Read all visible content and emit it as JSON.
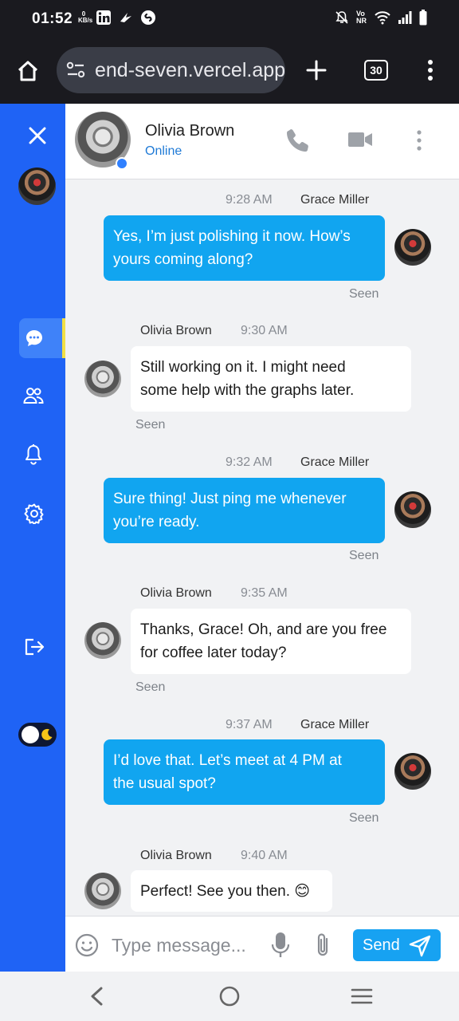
{
  "status_bar": {
    "time": "01:52",
    "data_speed": "0 KB/s",
    "icons_left": [
      "linkedin-icon",
      "bird-icon",
      "shazam-icon"
    ],
    "icons_right": [
      "mute-icon",
      "volte-icon",
      "wifi-icon",
      "signal-icon",
      "battery-icon"
    ]
  },
  "browser": {
    "url": "end-seven.vercel.app",
    "tab_count": "30"
  },
  "sidebar": {
    "items": [
      "close",
      "profile",
      "chats",
      "contacts",
      "notifications",
      "settings",
      "logout",
      "theme-toggle"
    ],
    "active": "chats"
  },
  "header": {
    "contact_name": "Olivia Brown",
    "contact_status": "Online"
  },
  "messages": [
    {
      "direction": "out",
      "sender": "Grace Miller",
      "time": "9:28 AM",
      "lines": [
        "Yes, I’m just polishing it now. How’s",
        "yours coming along?"
      ],
      "status": "Seen"
    },
    {
      "direction": "in",
      "sender": "Olivia Brown",
      "time": "9:30 AM",
      "lines": [
        "Still working on it. I might need",
        "some help with the graphs later."
      ],
      "status": "Seen"
    },
    {
      "direction": "out",
      "sender": "Grace Miller",
      "time": "9:32 AM",
      "lines": [
        "Sure thing! Just ping me whenever",
        "you’re ready."
      ],
      "status": "Seen"
    },
    {
      "direction": "in",
      "sender": "Olivia Brown",
      "time": "9:35 AM",
      "lines": [
        "Thanks, Grace! Oh, and are you free",
        "for coffee later today?"
      ],
      "status": "Seen"
    },
    {
      "direction": "out",
      "sender": "Grace Miller",
      "time": "9:37 AM",
      "lines": [
        "I’d love that. Let’s meet at 4 PM at",
        "the usual spot?"
      ],
      "status": "Seen"
    },
    {
      "direction": "in",
      "sender": "Olivia Brown",
      "time": "9:40 AM",
      "lines": [
        "Perfect! See you then. 😊"
      ],
      "status": ""
    }
  ],
  "composer": {
    "placeholder": "Type message...",
    "send_label": "Send"
  },
  "colors": {
    "sidebar": "#1f63f5",
    "outgoing_bubble": "#11a5f0",
    "incoming_bubble": "#ffffff",
    "send_button": "#17a2f2",
    "online_text": "#1f7ad6",
    "active_indicator": "#f2e045"
  }
}
